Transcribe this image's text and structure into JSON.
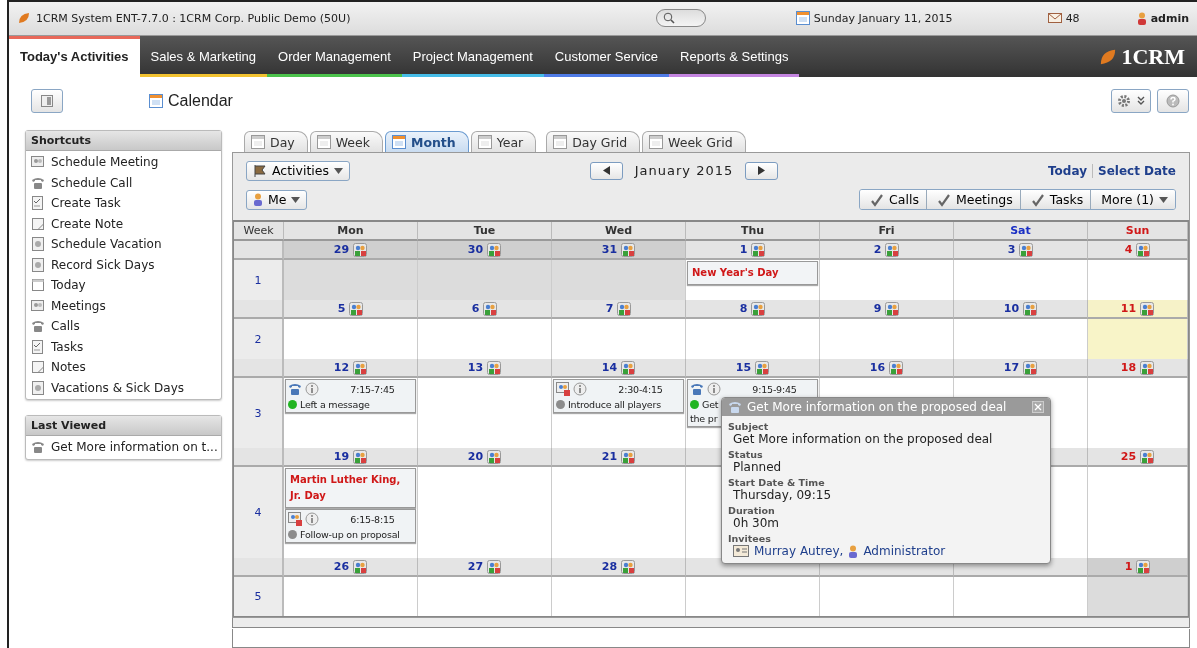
{
  "window": {
    "title": "1CRM System ENT-7.7.0 : 1CRM Corp. Public Demo (50U)",
    "date": "Sunday January 11, 2015",
    "mail_count": "48",
    "user": "admin"
  },
  "nav": {
    "tabs": [
      {
        "label": "Today's Activities",
        "selected": true,
        "color": "#e8685a"
      },
      {
        "label": "Sales & Marketing",
        "selected": false,
        "color": "#f2c230"
      },
      {
        "label": "Order Management",
        "selected": false,
        "color": "#4cc24c"
      },
      {
        "label": "Project Management",
        "selected": false,
        "color": "#46bde8"
      },
      {
        "label": "Customer Service",
        "selected": false,
        "color": "#4f7be6"
      },
      {
        "label": "Reports & Settings",
        "selected": false,
        "color": "#c485e0"
      }
    ],
    "logo": "1CRM"
  },
  "page": {
    "title": "Calendar"
  },
  "shortcuts": {
    "title": "Shortcuts",
    "items": [
      {
        "label": "Schedule Meeting",
        "kind": "meeting"
      },
      {
        "label": "Schedule Call",
        "kind": "call"
      },
      {
        "label": "Create Task",
        "kind": "task"
      },
      {
        "label": "Create Note",
        "kind": "note"
      },
      {
        "label": "Schedule Vacation",
        "kind": "vacation"
      },
      {
        "label": "Record Sick Days",
        "kind": "vacation"
      },
      {
        "label": "Today",
        "kind": "calendar"
      },
      {
        "label": "Meetings",
        "kind": "meeting"
      },
      {
        "label": "Calls",
        "kind": "call"
      },
      {
        "label": "Tasks",
        "kind": "task"
      },
      {
        "label": "Notes",
        "kind": "note"
      },
      {
        "label": "Vacations & Sick Days",
        "kind": "vacation"
      }
    ]
  },
  "last_viewed": {
    "title": "Last Viewed",
    "items": [
      {
        "label": "Get More information on t...",
        "kind": "call"
      }
    ]
  },
  "view_tab_groups": [
    {
      "tabs": [
        {
          "label": "Day",
          "selected": false
        },
        {
          "label": "Week",
          "selected": false
        },
        {
          "label": "Month",
          "selected": true
        },
        {
          "label": "Year",
          "selected": false
        }
      ]
    },
    {
      "tabs": [
        {
          "label": "Day Grid",
          "selected": false
        },
        {
          "label": "Week Grid",
          "selected": false
        }
      ]
    }
  ],
  "toolbar": {
    "activities": "Activities",
    "user": "Me",
    "month": "January 2015",
    "today": "Today",
    "select_date": "Select Date",
    "filters": [
      {
        "label": "Calls",
        "checked": true
      },
      {
        "label": "Meetings",
        "checked": true
      },
      {
        "label": "Tasks",
        "checked": true
      }
    ],
    "more": "More (1)"
  },
  "calendar": {
    "week_label": "Week",
    "columns": [
      {
        "label": "Mon",
        "kind": "weekday"
      },
      {
        "label": "Tue",
        "kind": "weekday"
      },
      {
        "label": "Wed",
        "kind": "weekday"
      },
      {
        "label": "Thu",
        "kind": "weekday"
      },
      {
        "label": "Fri",
        "kind": "weekday"
      },
      {
        "label": "Sat",
        "kind": "saturday"
      },
      {
        "label": "Sun",
        "kind": "sunday"
      }
    ],
    "weeks": [
      {
        "number": "1",
        "days": [
          {
            "day": "29",
            "other_month": true,
            "today": false
          },
          {
            "day": "30",
            "other_month": true,
            "today": false
          },
          {
            "day": "31",
            "other_month": true,
            "today": false
          },
          {
            "day": "1",
            "other_month": false,
            "today": false,
            "events": [
              {
                "kind": "holiday",
                "title": "New Year's Day"
              }
            ]
          },
          {
            "day": "2",
            "other_month": false,
            "today": false
          },
          {
            "day": "3",
            "other_month": false,
            "today": false
          },
          {
            "day": "4",
            "other_month": false,
            "today": false
          }
        ]
      },
      {
        "number": "2",
        "days": [
          {
            "day": "5",
            "other_month": false,
            "today": false
          },
          {
            "day": "6",
            "other_month": false,
            "today": false
          },
          {
            "day": "7",
            "other_month": false,
            "today": false
          },
          {
            "day": "8",
            "other_month": false,
            "today": false
          },
          {
            "day": "9",
            "other_month": false,
            "today": false
          },
          {
            "day": "10",
            "other_month": false,
            "today": false
          },
          {
            "day": "11",
            "other_month": false,
            "today": true
          }
        ]
      },
      {
        "number": "3",
        "days": [
          {
            "day": "12",
            "other_month": false,
            "today": false,
            "events": [
              {
                "kind": "call",
                "time": "7:15-7:45",
                "lines": [
                  "Left a message"
                ],
                "color": "#22b422"
              }
            ]
          },
          {
            "day": "13",
            "other_month": false,
            "today": false
          },
          {
            "day": "14",
            "other_month": false,
            "today": false,
            "events": [
              {
                "kind": "meeting",
                "time": "2:30-4:15",
                "lines": [
                  "Introduce all players"
                ],
                "color": "#8c8c8c"
              }
            ]
          },
          {
            "day": "15",
            "other_month": false,
            "today": false,
            "events": [
              {
                "kind": "call",
                "time": "9:15-9:45",
                "lines": [
                  "Get",
                  "the pr"
                ],
                "color": "#22b422"
              }
            ]
          },
          {
            "day": "16",
            "other_month": false,
            "today": false
          },
          {
            "day": "17",
            "other_month": false,
            "today": false
          },
          {
            "day": "18",
            "other_month": false,
            "today": false
          }
        ]
      },
      {
        "number": "4",
        "days": [
          {
            "day": "19",
            "other_month": false,
            "today": false,
            "events": [
              {
                "kind": "holiday",
                "title": "Martin Luther King, Jr. Day"
              },
              {
                "kind": "meeting",
                "time": "6:15-8:15",
                "lines": [
                  "Follow-up on proposal"
                ],
                "color": "#8c8c8c"
              }
            ]
          },
          {
            "day": "20",
            "other_month": false,
            "today": false
          },
          {
            "day": "21",
            "other_month": false,
            "today": false
          }
        ],
        "days_end": [
          {
            "day": "25",
            "other_month": false,
            "today": false
          }
        ]
      },
      {
        "number": "5",
        "days": [
          {
            "day": "26",
            "other_month": false,
            "today": false
          },
          {
            "day": "27",
            "other_month": false,
            "today": false
          },
          {
            "day": "28",
            "other_month": false,
            "today": false
          }
        ],
        "days_end": [
          {
            "day": "1",
            "other_month": true,
            "today": false
          }
        ]
      }
    ]
  },
  "popup": {
    "title": "Get More information on the proposed deal",
    "fields": [
      {
        "label": "Subject",
        "value": "Get More information on the proposed deal"
      },
      {
        "label": "Status",
        "value": "Planned"
      },
      {
        "label": "Start Date & Time",
        "value": "Thursday, 09:15"
      },
      {
        "label": "Duration",
        "value": "0h 30m"
      }
    ],
    "invitees_label": "Invitees",
    "invitees": [
      {
        "name": "Murray Autrey,",
        "kind": "contact"
      },
      {
        "name": "Administrator",
        "kind": "user"
      }
    ]
  }
}
